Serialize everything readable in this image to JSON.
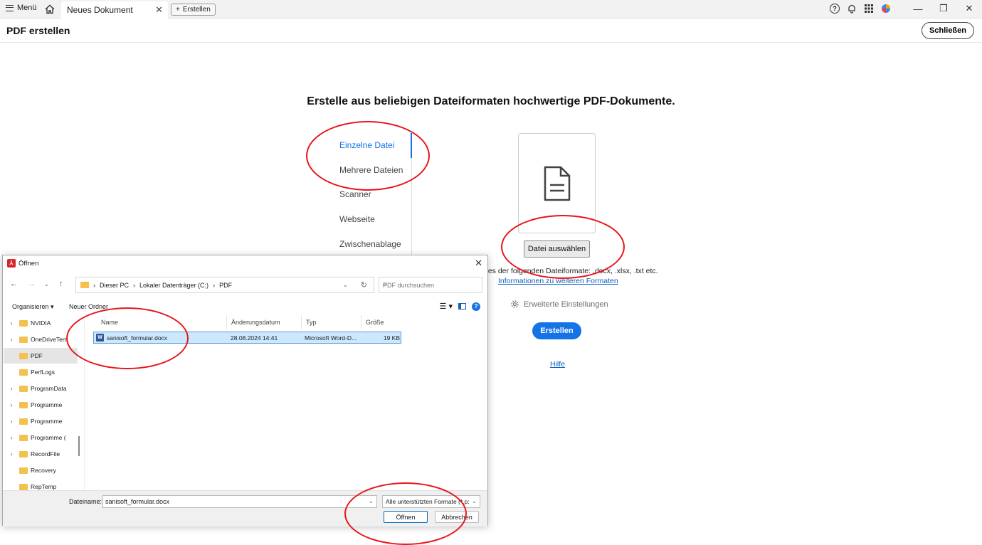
{
  "topbar": {
    "menu_label": "Menü",
    "tab_title": "Neues Dokument",
    "new_tab_label": "Erstellen",
    "icons": [
      "help-icon",
      "bell-icon",
      "apps-grid-icon",
      "profile-icon"
    ]
  },
  "header": {
    "title": "PDF erstellen",
    "close_label": "Schließen"
  },
  "main": {
    "headline": "Erstelle aus beliebigen Dateiformaten hochwertige PDF-Dokumente.",
    "sources": [
      "Einzelne Datei",
      "Mehrere Dateien",
      "Scanner",
      "Webseite",
      "Zwischenablage"
    ],
    "active_source": "Einzelne Datei",
    "choose_file_label": "Datei auswählen",
    "formats_text": "nes der folgenden Dateiformate: .docx, .xlsx, .txt etc.",
    "formats_link": "Informationen zu weiteren Formaten",
    "advanced_settings": "Erweiterte Einstellungen",
    "create_label": "Erstellen",
    "help_link": "Hilfe",
    "accent_color": "#1473e6"
  },
  "dialog": {
    "title": "Öffnen",
    "breadcrumbs": [
      "Dieser PC",
      "Lokaler Datenträger (C:)",
      "PDF"
    ],
    "search_placeholder": "PDF durchsuchen",
    "organize_label": "Organisieren",
    "new_folder_label": "Neuer Ordner",
    "nav_items": [
      {
        "label": "NVIDIA",
        "expandable": true,
        "selected": false
      },
      {
        "label": "OneDriveTem",
        "expandable": true,
        "selected": false
      },
      {
        "label": "PDF",
        "expandable": false,
        "selected": true
      },
      {
        "label": "PerfLogs",
        "expandable": false,
        "selected": false
      },
      {
        "label": "ProgramData",
        "expandable": true,
        "selected": false
      },
      {
        "label": "Programme",
        "expandable": true,
        "selected": false
      },
      {
        "label": "Programme",
        "expandable": true,
        "selected": false
      },
      {
        "label": "Programme (",
        "expandable": true,
        "selected": false
      },
      {
        "label": "RecordFile",
        "expandable": true,
        "selected": false
      },
      {
        "label": "Recovery",
        "expandable": false,
        "selected": false
      },
      {
        "label": "RepTemp",
        "expandable": false,
        "selected": false
      }
    ],
    "columns": [
      "Name",
      "Änderungsdatum",
      "Typ",
      "Größe"
    ],
    "files": [
      {
        "name": "sanisoft_formular.docx",
        "modified": "28.08.2024 14:41",
        "type": "Microsoft Word-D...",
        "size": "19 KB"
      }
    ],
    "filename_label": "Dateiname:",
    "filename_value": "sanisoft_formular.docx",
    "filter_value": "Alle unterstützten Formate (*.p:",
    "open_label": "Öffnen",
    "cancel_label": "Abbrechen"
  },
  "annotation_color": "#e8141a"
}
